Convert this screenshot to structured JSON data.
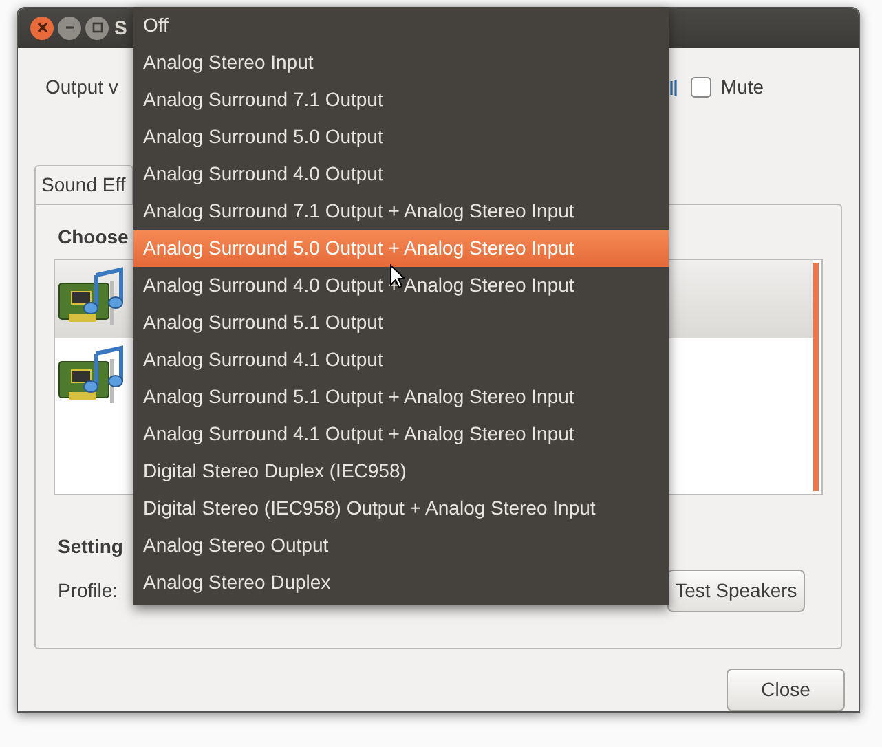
{
  "window": {
    "title": "S"
  },
  "output_volume": {
    "label": "Output v",
    "mute": {
      "label": "Mute",
      "checked": false
    }
  },
  "tabs": [
    {
      "label": "Sound Eff",
      "selected": true
    }
  ],
  "choose": {
    "heading": "Choose",
    "devices": [
      {
        "selected": true
      },
      {
        "selected": false
      }
    ]
  },
  "settings": {
    "heading": "Setting",
    "profile_label": "Profile:",
    "test_button": "Test Speakers"
  },
  "close_button": "Close",
  "profile_menu": {
    "items": [
      {
        "label": "Off",
        "selected": false
      },
      {
        "label": "Analog Stereo Input",
        "selected": false
      },
      {
        "label": "Analog Surround 7.1 Output",
        "selected": false
      },
      {
        "label": "Analog Surround 5.0 Output",
        "selected": false
      },
      {
        "label": "Analog Surround 4.0 Output",
        "selected": false
      },
      {
        "label": "Analog Surround 7.1 Output + Analog Stereo Input",
        "selected": false
      },
      {
        "label": "Analog Surround 5.0 Output + Analog Stereo Input",
        "selected": true
      },
      {
        "label": "Analog Surround 4.0 Output + Analog Stereo Input",
        "selected": false
      },
      {
        "label": "Analog Surround 5.1 Output",
        "selected": false
      },
      {
        "label": "Analog Surround 4.1 Output",
        "selected": false
      },
      {
        "label": "Analog Surround 5.1 Output + Analog Stereo Input",
        "selected": false
      },
      {
        "label": "Analog Surround 4.1 Output + Analog Stereo Input",
        "selected": false
      },
      {
        "label": "Digital Stereo Duplex (IEC958)",
        "selected": false
      },
      {
        "label": "Digital Stereo (IEC958) Output + Analog Stereo Input",
        "selected": false
      },
      {
        "label": "Analog Stereo Output",
        "selected": false
      },
      {
        "label": "Analog Stereo Duplex",
        "selected": false
      }
    ]
  }
}
